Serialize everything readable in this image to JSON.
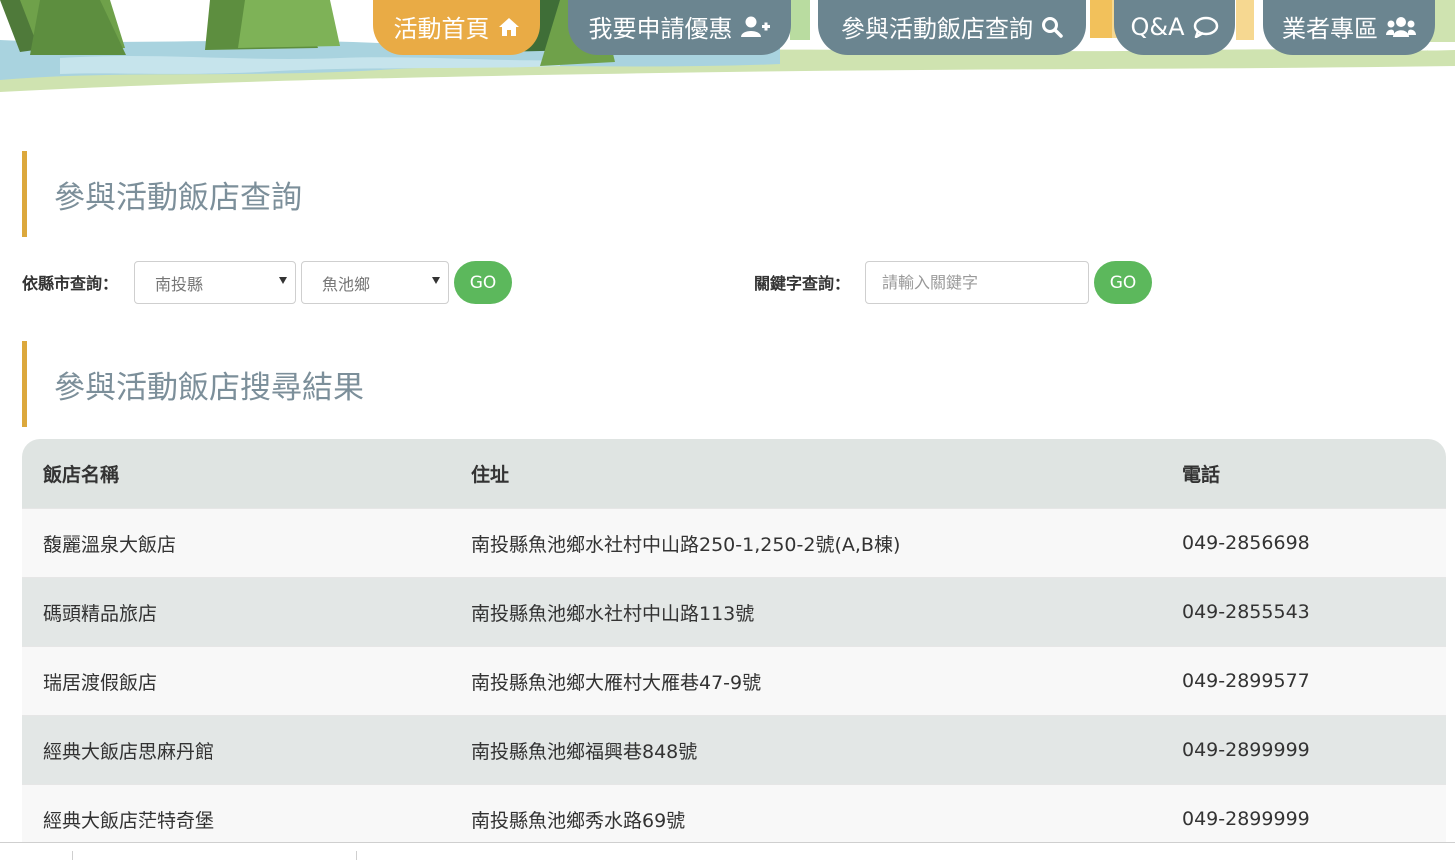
{
  "nav": {
    "items": [
      {
        "label": "活動首頁",
        "icon": "home-icon",
        "active": true
      },
      {
        "label": "我要申請優惠",
        "icon": "user-plus-icon",
        "active": false
      },
      {
        "label": "參與活動飯店查詢",
        "icon": "search-icon",
        "active": false
      },
      {
        "label": "Q&A",
        "icon": "chat-bubble-icon",
        "active": false
      },
      {
        "label": "業者專區",
        "icon": "users-icon",
        "active": false
      }
    ]
  },
  "search_section": {
    "title": "參與活動飯店查詢",
    "city_filter": {
      "label": "依縣市查詢：",
      "county_value": "南投縣",
      "township_value": "魚池鄉",
      "go_label": "GO"
    },
    "keyword_filter": {
      "label": "關鍵字查詢：",
      "placeholder": "請輸入關鍵字",
      "go_label": "GO"
    }
  },
  "results_section": {
    "title": "參與活動飯店搜尋結果",
    "table": {
      "headers": [
        "飯店名稱",
        "住址",
        "電話"
      ],
      "rows": [
        [
          "馥麗溫泉大飯店",
          "南投縣魚池鄉水社村中山路250-1,250-2號(A,B棟)",
          "049-2856698"
        ],
        [
          "碼頭精品旅店",
          "南投縣魚池鄉水社村中山路113號",
          "049-2855543"
        ],
        [
          "瑞居渡假飯店",
          "南投縣魚池鄉大雁村大雁巷47-9號",
          "049-2899577"
        ],
        [
          "經典大飯店思麻丹館",
          "南投縣魚池鄉福興巷848號",
          "049-2899999"
        ],
        [
          "經典大飯店茫特奇堡",
          "南投縣魚池鄉秀水路69號",
          "049-2899999"
        ]
      ]
    }
  },
  "colors": {
    "nav_active": "#e9ab45",
    "nav_default": "#6b8590",
    "go_button": "#5cb85c",
    "section_accent": "#dca83c",
    "section_title_text": "#7c8f9a"
  }
}
